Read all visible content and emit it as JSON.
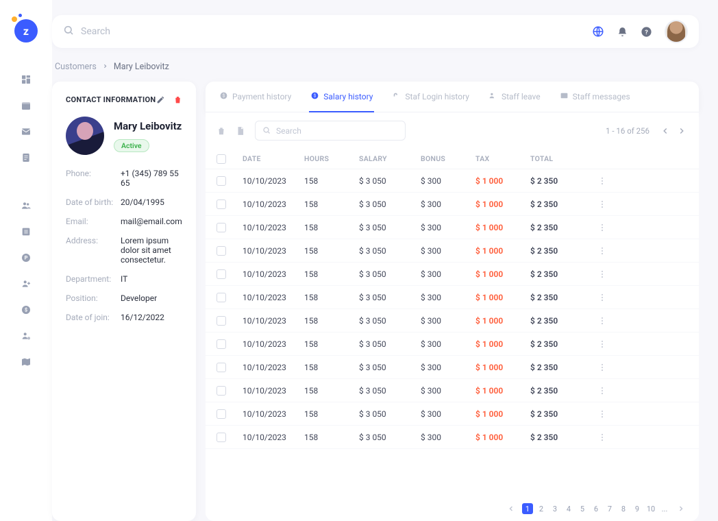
{
  "header": {
    "search_placeholder": "Search"
  },
  "breadcrumb": {
    "root": "Customers",
    "current": "Mary Leibovitz"
  },
  "contact": {
    "panel_title": "CONTACT INFORMATION",
    "name": "Mary Leibovitz",
    "status": "Active",
    "fields": [
      {
        "k": "Phone:",
        "v": "+1 (345) 789 55 65"
      },
      {
        "k": "Date of birth:",
        "v": "20/04/1995"
      },
      {
        "k": "Email:",
        "v": "mail@email.com"
      },
      {
        "k": "Address:",
        "v": "Lorem ipsum dolor sit amet consectetur."
      },
      {
        "k": "Department:",
        "v": "IT"
      },
      {
        "k": "Position:",
        "v": "Developer"
      },
      {
        "k": "Date of join:",
        "v": "16/12/2022"
      }
    ]
  },
  "tabs": [
    "Payment  history",
    "Salary history",
    "Staf Login history",
    "Staff leave",
    "Staff messages"
  ],
  "active_tab": 1,
  "toolbar": {
    "search_placeholder": "Search",
    "range": "1 - 16 of 256"
  },
  "table": {
    "headers": [
      "DATE",
      "HOURS",
      "SALARY",
      "BONUS",
      "TAX",
      "TOTAL"
    ],
    "rows": [
      {
        "date": "10/10/2023",
        "hours": "158",
        "salary": "$ 3 050",
        "bonus": "$ 300",
        "tax": "$ 1 000",
        "total": "$ 2 350"
      },
      {
        "date": "10/10/2023",
        "hours": "158",
        "salary": "$ 3 050",
        "bonus": "$ 300",
        "tax": "$ 1 000",
        "total": "$ 2 350"
      },
      {
        "date": "10/10/2023",
        "hours": "158",
        "salary": "$ 3 050",
        "bonus": "$ 300",
        "tax": "$ 1 000",
        "total": "$ 2 350"
      },
      {
        "date": "10/10/2023",
        "hours": "158",
        "salary": "$ 3 050",
        "bonus": "$ 300",
        "tax": "$ 1 000",
        "total": "$ 2 350"
      },
      {
        "date": "10/10/2023",
        "hours": "158",
        "salary": "$ 3 050",
        "bonus": "$ 300",
        "tax": "$ 1 000",
        "total": "$ 2 350"
      },
      {
        "date": "10/10/2023",
        "hours": "158",
        "salary": "$ 3 050",
        "bonus": "$ 300",
        "tax": "$ 1 000",
        "total": "$ 2 350"
      },
      {
        "date": "10/10/2023",
        "hours": "158",
        "salary": "$ 3 050",
        "bonus": "$ 300",
        "tax": "$ 1 000",
        "total": "$ 2 350"
      },
      {
        "date": "10/10/2023",
        "hours": "158",
        "salary": "$ 3 050",
        "bonus": "$ 300",
        "tax": "$ 1 000",
        "total": "$ 2 350"
      },
      {
        "date": "10/10/2023",
        "hours": "158",
        "salary": "$ 3 050",
        "bonus": "$ 300",
        "tax": "$ 1 000",
        "total": "$ 2 350"
      },
      {
        "date": "10/10/2023",
        "hours": "158",
        "salary": "$ 3 050",
        "bonus": "$ 300",
        "tax": "$ 1 000",
        "total": "$ 2 350"
      },
      {
        "date": "10/10/2023",
        "hours": "158",
        "salary": "$ 3 050",
        "bonus": "$ 300",
        "tax": "$ 1 000",
        "total": "$ 2 350"
      },
      {
        "date": "10/10/2023",
        "hours": "158",
        "salary": "$ 3 050",
        "bonus": "$ 300",
        "tax": "$ 1 000",
        "total": "$ 2 350"
      }
    ]
  },
  "pagination": {
    "pages": [
      "1",
      "2",
      "3",
      "4",
      "5",
      "6",
      "7",
      "8",
      "9",
      "10",
      "..."
    ],
    "current": "1"
  },
  "rail_icons": [
    "dashboard-icon",
    "calendar-icon",
    "mail-icon",
    "notes-icon",
    "users-icon",
    "list-icon",
    "currency-icon",
    "user-add-icon",
    "money-icon",
    "person-settings-icon",
    "map-icon"
  ]
}
